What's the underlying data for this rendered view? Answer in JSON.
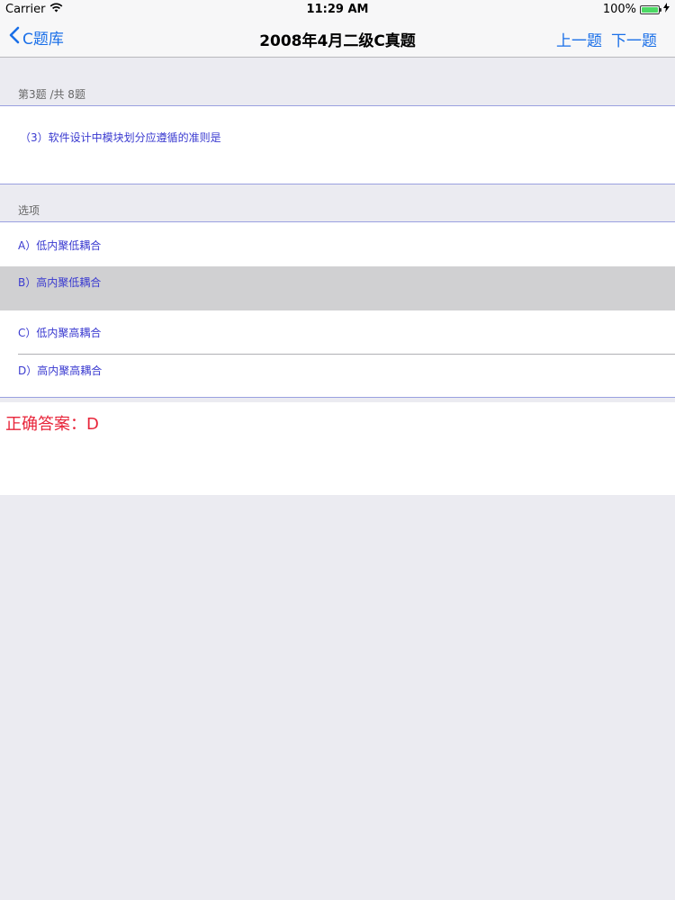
{
  "status_bar": {
    "carrier": "Carrier",
    "time": "11:29 AM",
    "battery_text": "100%",
    "battery_level": 1.0
  },
  "nav": {
    "back_label": "C题库",
    "title": "2008年4月二级C真题",
    "prev_label": "上一题",
    "next_label": "下一题"
  },
  "question": {
    "counter": "第3题 /共 8题",
    "text": "（3）软件设计中模块划分应遵循的准则是"
  },
  "options": {
    "header": "选项",
    "items": [
      {
        "label": "A）低内聚低耦合",
        "selected": false
      },
      {
        "label": "B）高内聚低耦合",
        "selected": true
      },
      {
        "label": "C）低内聚高耦合",
        "selected": false
      },
      {
        "label": "D）高内聚高耦合",
        "selected": false
      }
    ]
  },
  "answer": {
    "text": "正确答案：D"
  },
  "colors": {
    "accent": "#1a6fe8",
    "option_text": "#3a3ad0",
    "answer": "#e8253a",
    "selected_bg": "#d0d0d2"
  }
}
